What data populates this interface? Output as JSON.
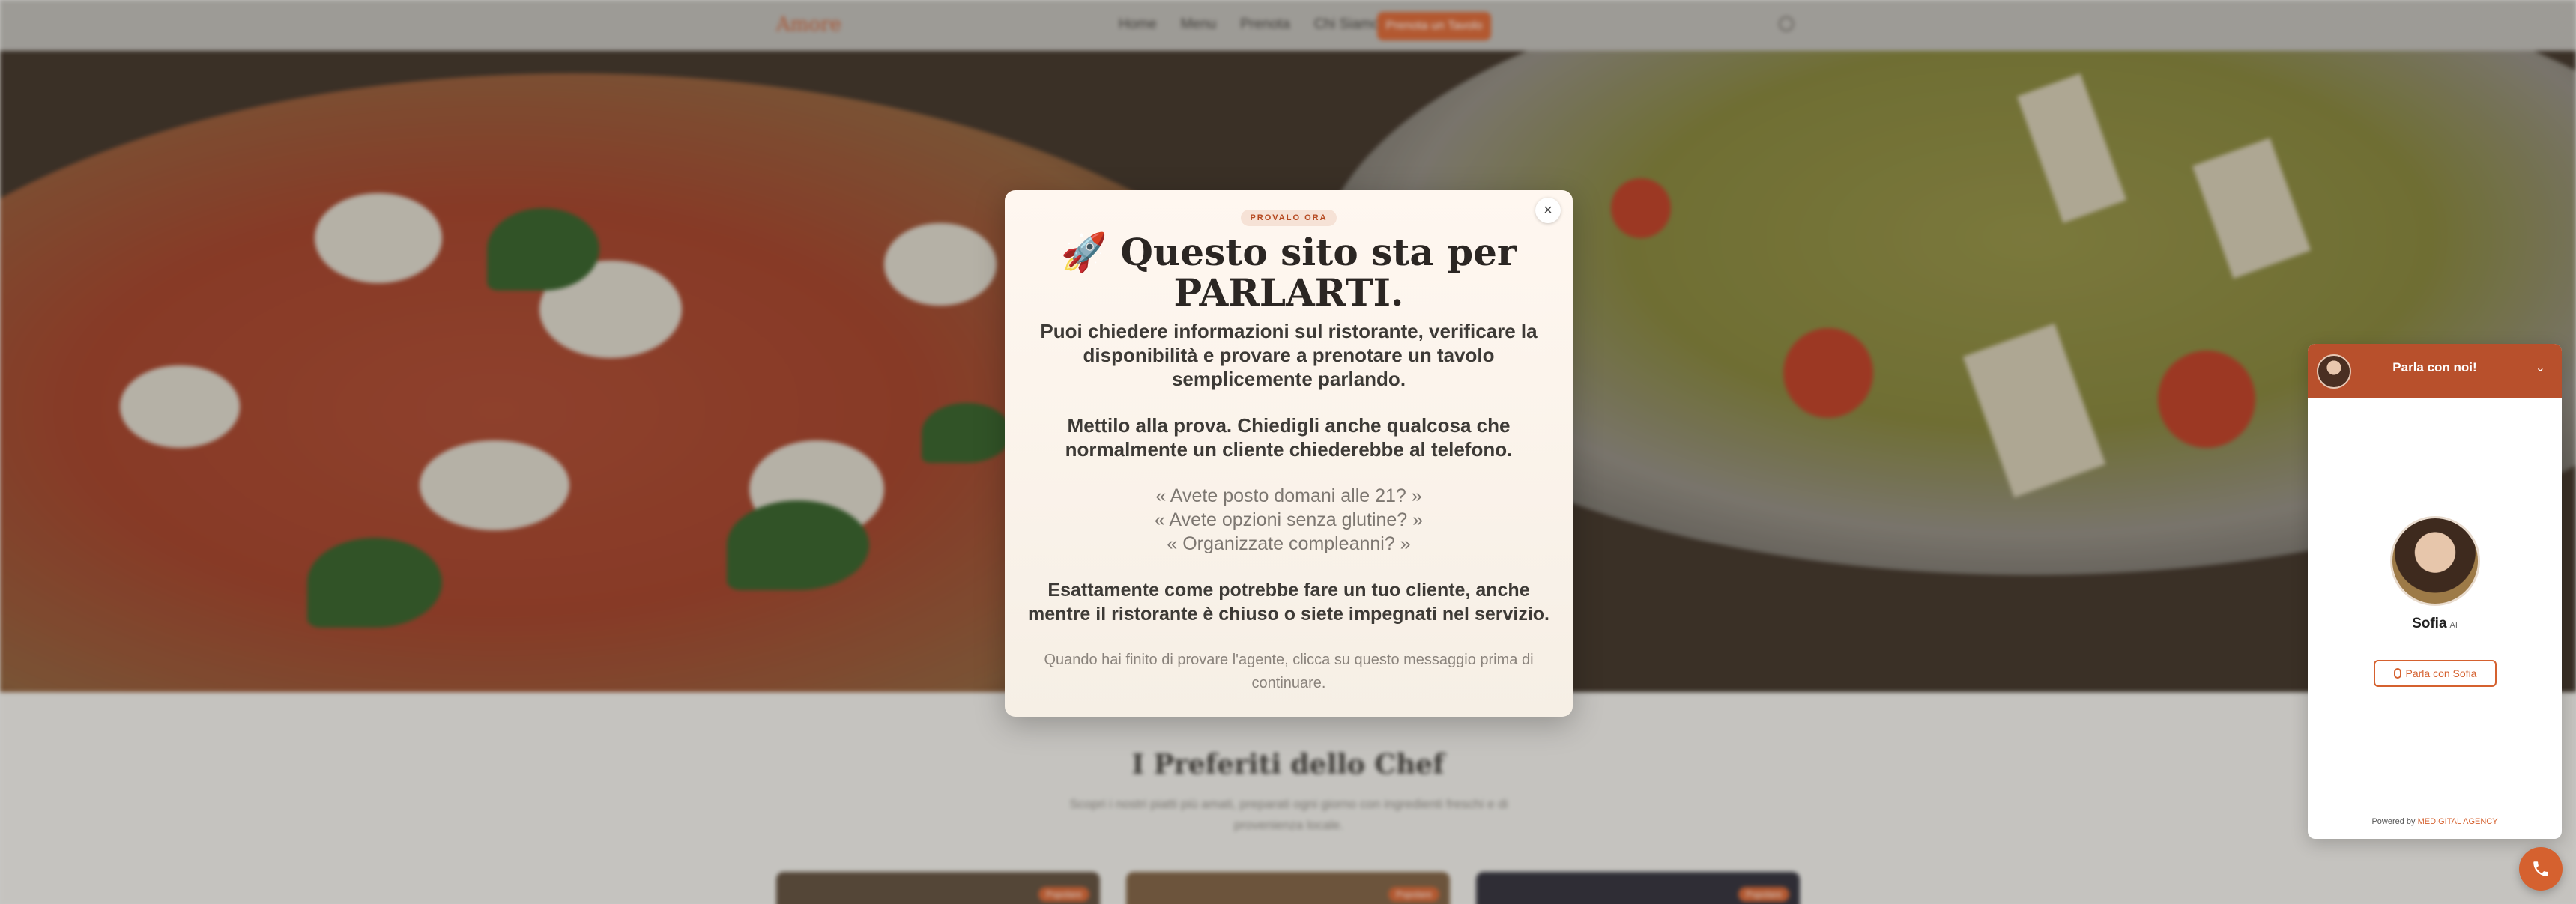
{
  "nav": {
    "logo": "Amore",
    "links": [
      "Home",
      "Menu",
      "Prenota",
      "Chi Siamo"
    ],
    "cta": "Prenota un Tavolo"
  },
  "section": {
    "title": "I Preferiti dello Chef",
    "subtitle": "Scopri i nostri piatti più amati, preparati ogni giorno con ingredienti freschi e di provenienza locale.",
    "card_badge": "Popolare"
  },
  "modal": {
    "eyebrow": "PROVALO ORA",
    "title": "🚀 Questo sito sta per PARLARTI.",
    "p1": "Puoi chiedere informazioni sul ristorante, verificare la disponibilità e provare a prenotare un tavolo semplicemente parlando.",
    "p2": "Mettilo alla prova. Chiedigli anche qualcosa che normalmente un cliente chiederebbe al telefono.",
    "quotes": [
      "« Avete posto domani alle 21? »",
      "« Avete opzioni senza glutine? »",
      "« Organizzate compleanni? »"
    ],
    "p3": "Esattamente come potrebbe fare un tuo cliente, anche mentre il ristorante è chiuso o siete impegnati nel servizio.",
    "footer": "Quando hai finito di provare l'agente, clicca su questo messaggio prima di continuare.",
    "close": "×"
  },
  "chat": {
    "header": "Parla con noi!",
    "agent_name": "Sofia",
    "agent_badge": "AI",
    "button": "Parla con Sofia",
    "powered_prefix": "Powered by",
    "powered_brand": "MEDIGITAL AGENCY",
    "chevron": "⌄"
  },
  "call_button_icon": "phone-icon"
}
